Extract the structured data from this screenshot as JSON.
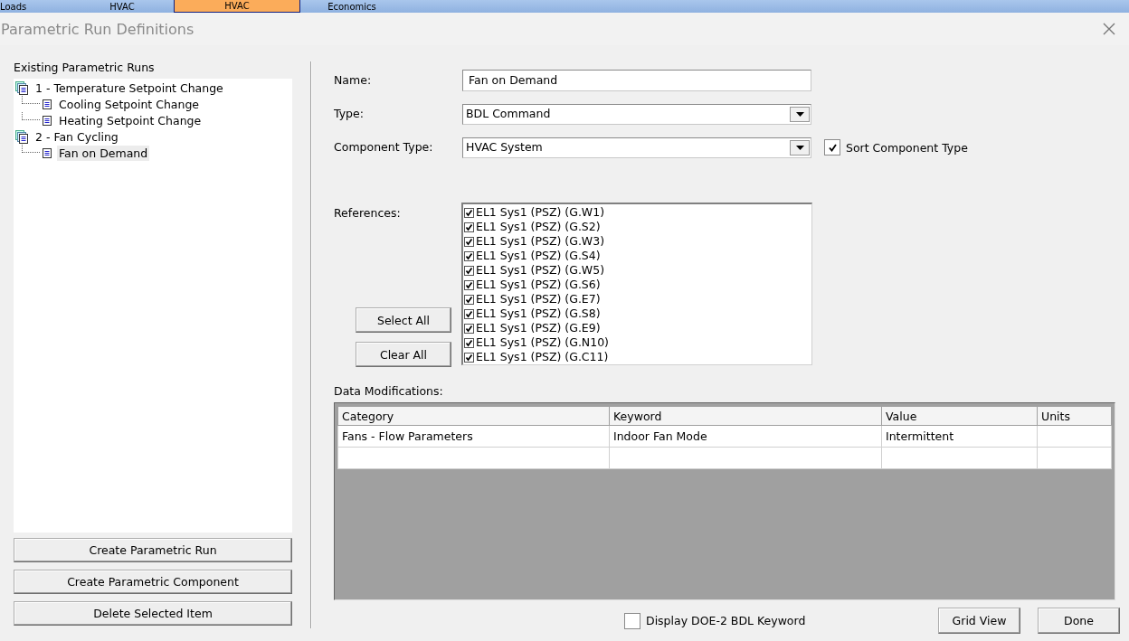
{
  "top_tabs": [
    {
      "label": "Loads",
      "selected": false
    },
    {
      "label": "HVAC",
      "selected": false
    },
    {
      "label": "HVAC",
      "selected": true
    },
    {
      "label": "Economics",
      "selected": false
    }
  ],
  "window": {
    "title": "Parametric Run Definitions"
  },
  "runs_panel": {
    "label": "Existing Parametric Runs",
    "tree": [
      {
        "label": "1 - Temperature Setpoint Change",
        "selected": false,
        "children": [
          {
            "label": "Cooling Setpoint Change",
            "selected": false
          },
          {
            "label": "Heating Setpoint Change",
            "selected": false
          }
        ]
      },
      {
        "label": "2 - Fan Cycling",
        "selected": false,
        "children": [
          {
            "label": "Fan on Demand",
            "selected": true
          }
        ]
      }
    ],
    "buttons": [
      "Create Parametric Run",
      "Create Parametric Component",
      "Delete Selected Item"
    ]
  },
  "form": {
    "name": {
      "label": "Name:",
      "value": "Fan on Demand"
    },
    "type": {
      "label": "Type:",
      "value": "BDL Command"
    },
    "component_type": {
      "label": "Component Type:",
      "value": "HVAC System"
    },
    "sort_component_type": {
      "label": "Sort Component Type",
      "checked": true
    }
  },
  "references": {
    "label": "References:",
    "buttons": [
      "Select All",
      "Clear All"
    ],
    "items": [
      {
        "label": "EL1 Sys1 (PSZ) (G.W1)",
        "checked": true
      },
      {
        "label": "EL1 Sys1 (PSZ) (G.S2)",
        "checked": true
      },
      {
        "label": "EL1 Sys1 (PSZ) (G.W3)",
        "checked": true
      },
      {
        "label": "EL1 Sys1 (PSZ) (G.S4)",
        "checked": true
      },
      {
        "label": "EL1 Sys1 (PSZ) (G.W5)",
        "checked": true
      },
      {
        "label": "EL1 Sys1 (PSZ) (G.S6)",
        "checked": true
      },
      {
        "label": "EL1 Sys1 (PSZ) (G.E7)",
        "checked": true
      },
      {
        "label": "EL1 Sys1 (PSZ) (G.S8)",
        "checked": true
      },
      {
        "label": "EL1 Sys1 (PSZ) (G.E9)",
        "checked": true
      },
      {
        "label": "EL1 Sys1 (PSZ) (G.N10)",
        "checked": true
      },
      {
        "label": "EL1 Sys1 (PSZ) (G.C11)",
        "checked": true
      }
    ]
  },
  "data_modifications": {
    "label": "Data Modifications:",
    "columns": [
      "Category",
      "Keyword",
      "Value",
      "Units"
    ],
    "rows": [
      [
        "Fans - Flow Parameters",
        "Indoor Fan Mode",
        "Intermittent",
        null
      ]
    ]
  },
  "display_keyword": {
    "label": "Display DOE-2 BDL Keyword",
    "checked": false
  },
  "buttons": [
    "Grid View",
    "Done"
  ]
}
